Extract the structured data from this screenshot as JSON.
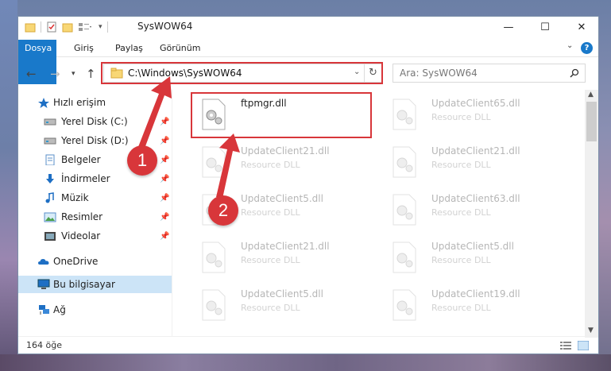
{
  "window": {
    "title": "SysWOW64",
    "controls": {
      "minimize": "—",
      "maximize": "☐",
      "close": "✕"
    }
  },
  "ribbon": {
    "tabs": [
      {
        "label": "Dosya",
        "active": true
      },
      {
        "label": "Giriş"
      },
      {
        "label": "Paylaş"
      },
      {
        "label": "Görünüm"
      }
    ],
    "help": "?"
  },
  "address": {
    "path": "C:\\Windows\\SysWOW64",
    "search_placeholder": "Ara: SysWOW64"
  },
  "sidebar": {
    "items": [
      {
        "label": "Hızlı erişim",
        "icon": "star-icon"
      },
      {
        "label": "Yerel Disk (C:)",
        "icon": "drive-icon",
        "pinned": true
      },
      {
        "label": "Yerel Disk (D:)",
        "icon": "drive-icon",
        "pinned": true
      },
      {
        "label": "Belgeler",
        "icon": "documents-icon",
        "pinned": true
      },
      {
        "label": "İndirmeler",
        "icon": "download-icon",
        "pinned": true
      },
      {
        "label": "Müzik",
        "icon": "music-icon",
        "pinned": true
      },
      {
        "label": "Resimler",
        "icon": "pictures-icon",
        "pinned": true
      },
      {
        "label": "Videolar",
        "icon": "videos-icon",
        "pinned": true
      },
      {
        "label": "OneDrive",
        "icon": "onedrive-icon"
      },
      {
        "label": "Bu bilgisayar",
        "icon": "computer-icon",
        "selected": true
      },
      {
        "label": "Ağ",
        "icon": "network-icon"
      }
    ]
  },
  "files": {
    "highlighted": {
      "name": "ftpmgr.dll",
      "type": ""
    },
    "background": [
      {
        "name": "UpdateClient65.dll",
        "type": "Resource DLL"
      },
      {
        "name": "UpdateClient21.dll",
        "type": "Resource DLL"
      },
      {
        "name": "UpdateClient21.dll",
        "type": "Resource DLL"
      },
      {
        "name": "UpdateClient5.dll",
        "type": "Resource DLL"
      },
      {
        "name": "UpdateClient63.dll",
        "type": "Resource DLL"
      },
      {
        "name": "UpdateClient21.dll",
        "type": "Resource DLL"
      },
      {
        "name": "UpdateClient5.dll",
        "type": "Resource DLL"
      },
      {
        "name": "UpdateClient5.dll",
        "type": "Resource DLL"
      },
      {
        "name": "UpdateClient19.dll",
        "type": "Resource DLL"
      }
    ]
  },
  "status": {
    "item_count": "164 öğe"
  },
  "annotations": {
    "step1": "1",
    "step2": "2",
    "color": "#d8363a"
  }
}
